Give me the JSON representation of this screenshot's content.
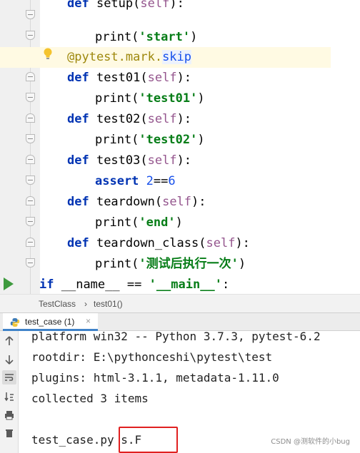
{
  "editor": {
    "lines": [
      {
        "kw": "def",
        "fn": " setup(",
        "slf": "self",
        "tail": "):"
      },
      {
        "call": "print(",
        "str": "'start'",
        "close": ")"
      },
      {
        "deco": "@pytest.mark.",
        "skip": "skip"
      },
      {
        "kw": "def",
        "fn": " test01(",
        "slf": "self",
        "tail": "):"
      },
      {
        "call": "print(",
        "str": "'test01'",
        "close": ")"
      },
      {
        "kw": "def",
        "fn": " test02(",
        "slf": "self",
        "tail": "):"
      },
      {
        "call": "print(",
        "str": "'test02'",
        "close": ")"
      },
      {
        "kw": "def",
        "fn": " test03(",
        "slf": "self",
        "tail": "):"
      },
      {
        "kw": "assert",
        "sp": " ",
        "num1": "2",
        "op": "==",
        "num2": "6"
      },
      {
        "kw": "def",
        "fn": " teardown(",
        "slf": "self",
        "tail": "):"
      },
      {
        "call": "print(",
        "str": "'end'",
        "close": ")"
      },
      {
        "kw": "def",
        "fn": " teardown_class(",
        "slf": "self",
        "tail": "):"
      },
      {
        "call": "print(",
        "str": "'测试后执行一次'",
        "close": ")"
      },
      {
        "kw": "if",
        "sp": " ",
        "name": "__name__",
        "op": " == ",
        "str": "'__main__'",
        "tail": ":"
      }
    ]
  },
  "breadcrumb": {
    "class": "TestClass",
    "sep": "›",
    "method": "test01()"
  },
  "run": {
    "tab_label": "test_case (1)",
    "close_glyph": "×",
    "console": [
      "platform win32 -- Python 3.7.3, pytest-6.2",
      "rootdir: E:\\pythonceshi\\pytest\\test",
      "plugins: html-3.1.1, metadata-1.11.0",
      "collected 3 items",
      "",
      "test_case.py s.F"
    ]
  },
  "watermark": "CSDN @测软件的小bug",
  "icons": [
    "bulb-icon",
    "run-icon",
    "python-icon",
    "up-icon",
    "down-icon",
    "soft-wrap-icon",
    "sort-icon",
    "print-icon",
    "delete-icon"
  ]
}
